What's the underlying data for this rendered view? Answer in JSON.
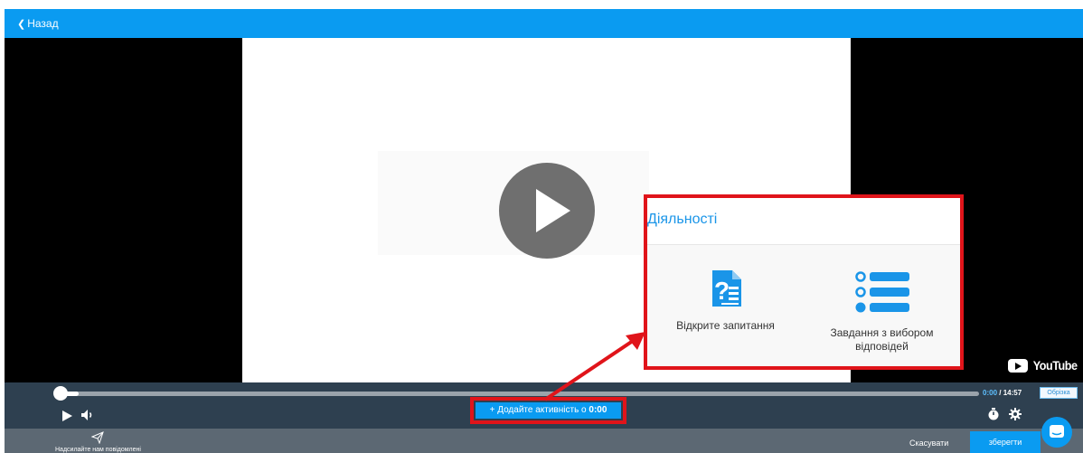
{
  "header": {
    "back_label": "Назад"
  },
  "video": {
    "branding": "YouTube"
  },
  "panel": {
    "title": "Діяльності",
    "activities": [
      {
        "label": "Відкрите запитання",
        "icon": "open-question-icon"
      },
      {
        "label": "Завдання з вибором відповідей",
        "icon": "multiple-choice-icon"
      }
    ]
  },
  "player": {
    "current_time": "0:00",
    "separator": " / ",
    "duration": "14:57",
    "trim_label": "Обрізка",
    "add_activity_prefix": "+ Додайте активність о",
    "add_activity_time": "0:00"
  },
  "footer": {
    "send_label": "Надсилайте нам повідомлені",
    "cancel_label": "Скасувати",
    "save_label": "зберегти"
  },
  "colors": {
    "accent": "#0a9bf1",
    "highlight": "#e0141a",
    "controls_bg": "#2e4050",
    "footer_bg": "#5c6873"
  }
}
